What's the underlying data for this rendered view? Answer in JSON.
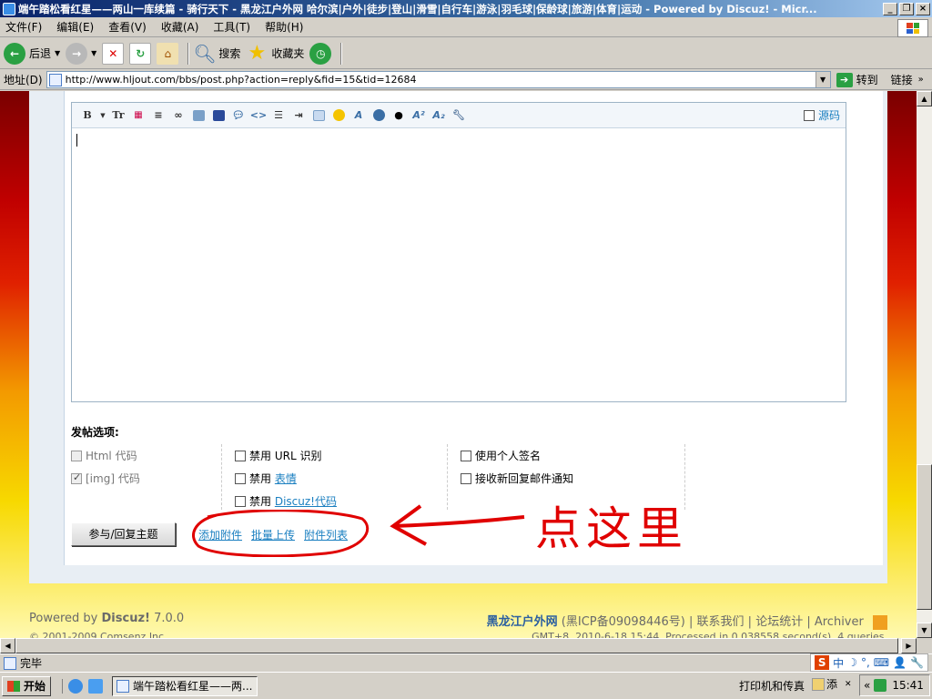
{
  "window": {
    "title": "端午踏松看红星——两山一库续篇 - 骑行天下 - 黑龙江户外网 哈尔滨|户外|徒步|登山|滑雪|自行车|游泳|羽毛球|保龄球|旅游|体育|运动 - Powered by Discuz! - Micr...",
    "buttons": [
      "_",
      "❐",
      "×"
    ]
  },
  "menu": [
    "文件(F)",
    "编辑(E)",
    "查看(V)",
    "收藏(A)",
    "工具(T)",
    "帮助(H)"
  ],
  "toolbar": {
    "back": "后退",
    "search": "搜索",
    "favorites": "收藏夹"
  },
  "address": {
    "label": "地址(D)",
    "url": "http://www.hljout.com/bbs/post.php?action=reply&fid=15&tid=12684",
    "go": "转到",
    "links": "链接"
  },
  "editor": {
    "source_label": "源码"
  },
  "options": {
    "title": "发帖选项:",
    "col1": [
      {
        "label": "Html 代码",
        "checked": false,
        "disabled": true
      },
      {
        "label": "[img] 代码",
        "checked": true,
        "disabled": true
      }
    ],
    "col2": [
      {
        "prefix": "禁用",
        "label": "URL 识别",
        "link": false
      },
      {
        "prefix": "禁用",
        "label": "表情",
        "link": true
      },
      {
        "prefix": "禁用",
        "label": "Discuz!代码",
        "link": true
      }
    ],
    "col3": [
      {
        "label": "使用个人签名"
      },
      {
        "label": "接收新回复邮件通知"
      }
    ]
  },
  "submit_label": "参与/回复主题",
  "attachments": [
    "添加附件",
    "批量上传",
    "附件列表"
  ],
  "annotation": "点这里",
  "footer": {
    "powered_prefix": "Powered by",
    "powered_brand": "Discuz!",
    "powered_version": "7.0.0",
    "copyright": "© 2001-2009 Comsenz Inc.",
    "site": "黑龙江户外网",
    "icp": "(黑ICP备09098446号)",
    "contact": "联系我们",
    "stats": "论坛统计",
    "archiver": "Archiver",
    "processed": "GMT+8, 2010-6-18 15:44, Processed in 0.038558 second(s), 4 queries."
  },
  "status": {
    "text": "完毕"
  },
  "ime": [
    "中",
    "☽",
    "°,",
    "⌨",
    "👤",
    "🔧"
  ],
  "taskbar": {
    "start": "开始",
    "task": "端午踏松看红星——两...",
    "printer": "打印机和传真",
    "extra": "添",
    "clock": "15:41"
  },
  "colors": {
    "link": "#1a7fc0",
    "annotation": "#e00000",
    "title_bar": "#0a246a"
  }
}
